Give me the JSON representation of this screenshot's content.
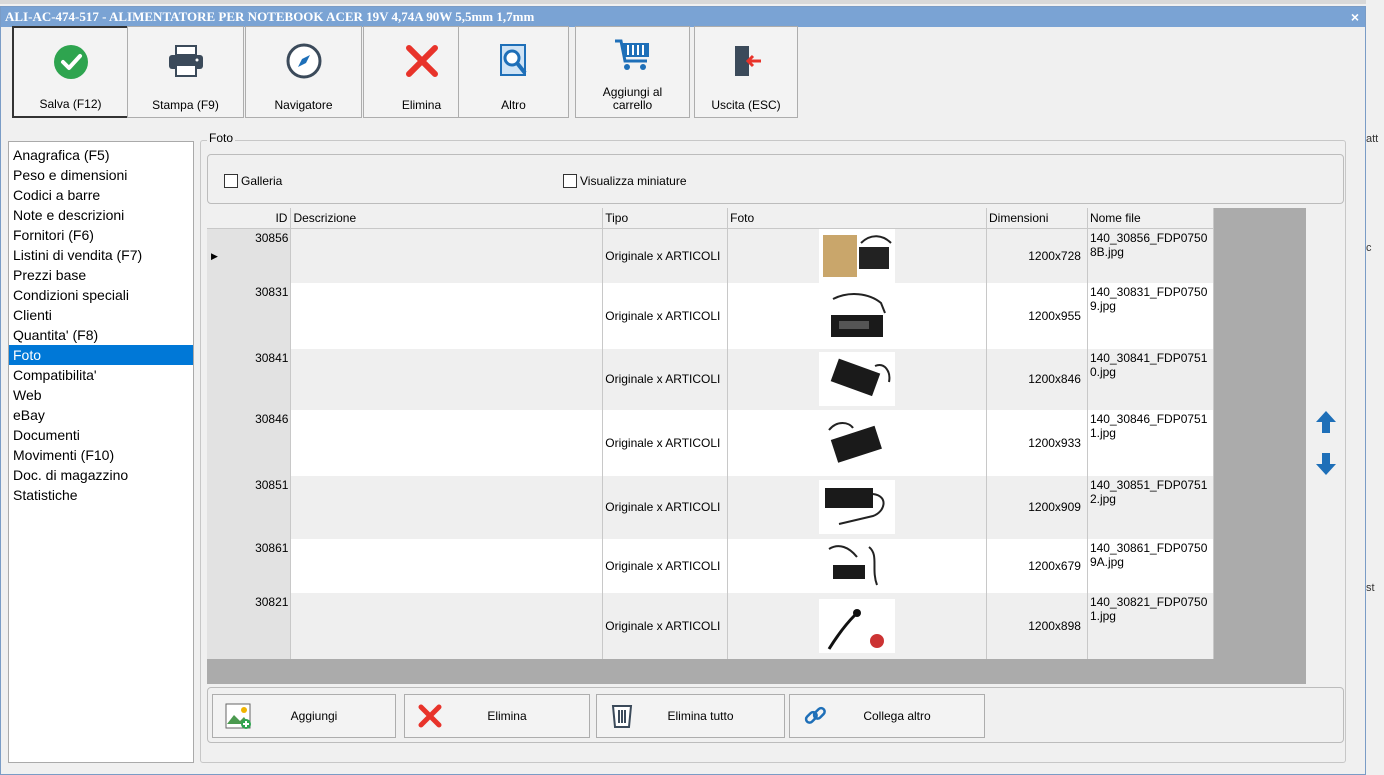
{
  "window": {
    "title": "ALI-AC-474-517 - ALIMENTATORE PER NOTEBOOK ACER 19V 4,74A 90W 5,5mm 1,7mm",
    "close_label": "×"
  },
  "background": {
    "right_labels": [
      "att",
      "c",
      "st"
    ]
  },
  "toolbar": [
    {
      "label": "Salva (F12)",
      "icon": "check-circle-icon"
    },
    {
      "label": "Stampa (F9)",
      "icon": "printer-icon"
    },
    {
      "label": "Navigatore",
      "icon": "compass-icon"
    },
    {
      "label": "Elimina",
      "icon": "red-x-icon"
    },
    {
      "label": "Altro",
      "icon": "magnifier-icon"
    },
    {
      "label": "Aggiungi al carrello",
      "icon": "cart-icon"
    },
    {
      "label": "Uscita (ESC)",
      "icon": "exit-door-icon"
    }
  ],
  "nav": {
    "items": [
      "Anagrafica (F5)",
      "Peso e dimensioni",
      "Codici a barre",
      "Note e descrizioni",
      "Fornitori (F6)",
      "Listini di vendita (F7)",
      "Prezzi base",
      "Condizioni speciali",
      "Clienti",
      "Quantita' (F8)",
      "Foto",
      "Compatibilita'",
      "Web",
      "eBay",
      "Documenti",
      "Movimenti (F10)",
      "Doc. di magazzino",
      "Statistiche"
    ],
    "selected": "Foto"
  },
  "foto": {
    "group_label": "Foto",
    "galleria_label": "Galleria",
    "miniature_label": "Visualizza miniature",
    "columns": {
      "id": "ID",
      "descrizione": "Descrizione",
      "tipo": "Tipo",
      "foto": "Foto",
      "dimensioni": "Dimensioni",
      "nome_file": "Nome file"
    },
    "rows": [
      {
        "id": "30856",
        "descrizione": "",
        "tipo": "Originale x ARTICOLI",
        "dimensioni": "1200x728",
        "nome_file": "140_30856_FDP07508B.jpg"
      },
      {
        "id": "30831",
        "descrizione": "",
        "tipo": "Originale x ARTICOLI",
        "dimensioni": "1200x955",
        "nome_file": "140_30831_FDP07509.jpg"
      },
      {
        "id": "30841",
        "descrizione": "",
        "tipo": "Originale x ARTICOLI",
        "dimensioni": "1200x846",
        "nome_file": "140_30841_FDP07510.jpg"
      },
      {
        "id": "30846",
        "descrizione": "",
        "tipo": "Originale x ARTICOLI",
        "dimensioni": "1200x933",
        "nome_file": "140_30846_FDP07511.jpg"
      },
      {
        "id": "30851",
        "descrizione": "",
        "tipo": "Originale x ARTICOLI",
        "dimensioni": "1200x909",
        "nome_file": "140_30851_FDP07512.jpg"
      },
      {
        "id": "30861",
        "descrizione": "",
        "tipo": "Originale x ARTICOLI",
        "dimensioni": "1200x679",
        "nome_file": "140_30861_FDP07509A.jpg"
      },
      {
        "id": "30821",
        "descrizione": "",
        "tipo": "Originale x ARTICOLI",
        "dimensioni": "1200x898",
        "nome_file": "140_30821_FDP07501.jpg"
      }
    ]
  },
  "bottom_buttons": [
    {
      "label": "Aggiungi",
      "icon": "add-image-icon"
    },
    {
      "label": "Elimina",
      "icon": "red-x-icon"
    },
    {
      "label": "Elimina tutto",
      "icon": "trash-icon"
    },
    {
      "label": "Collega altro",
      "icon": "link-icon"
    }
  ],
  "colors": {
    "title_bar": "#7aa3d4",
    "selection": "#0078d7",
    "accent_blue": "#1e6fb8",
    "delete_red": "#e8332a",
    "ok_green": "#2ea44f"
  }
}
